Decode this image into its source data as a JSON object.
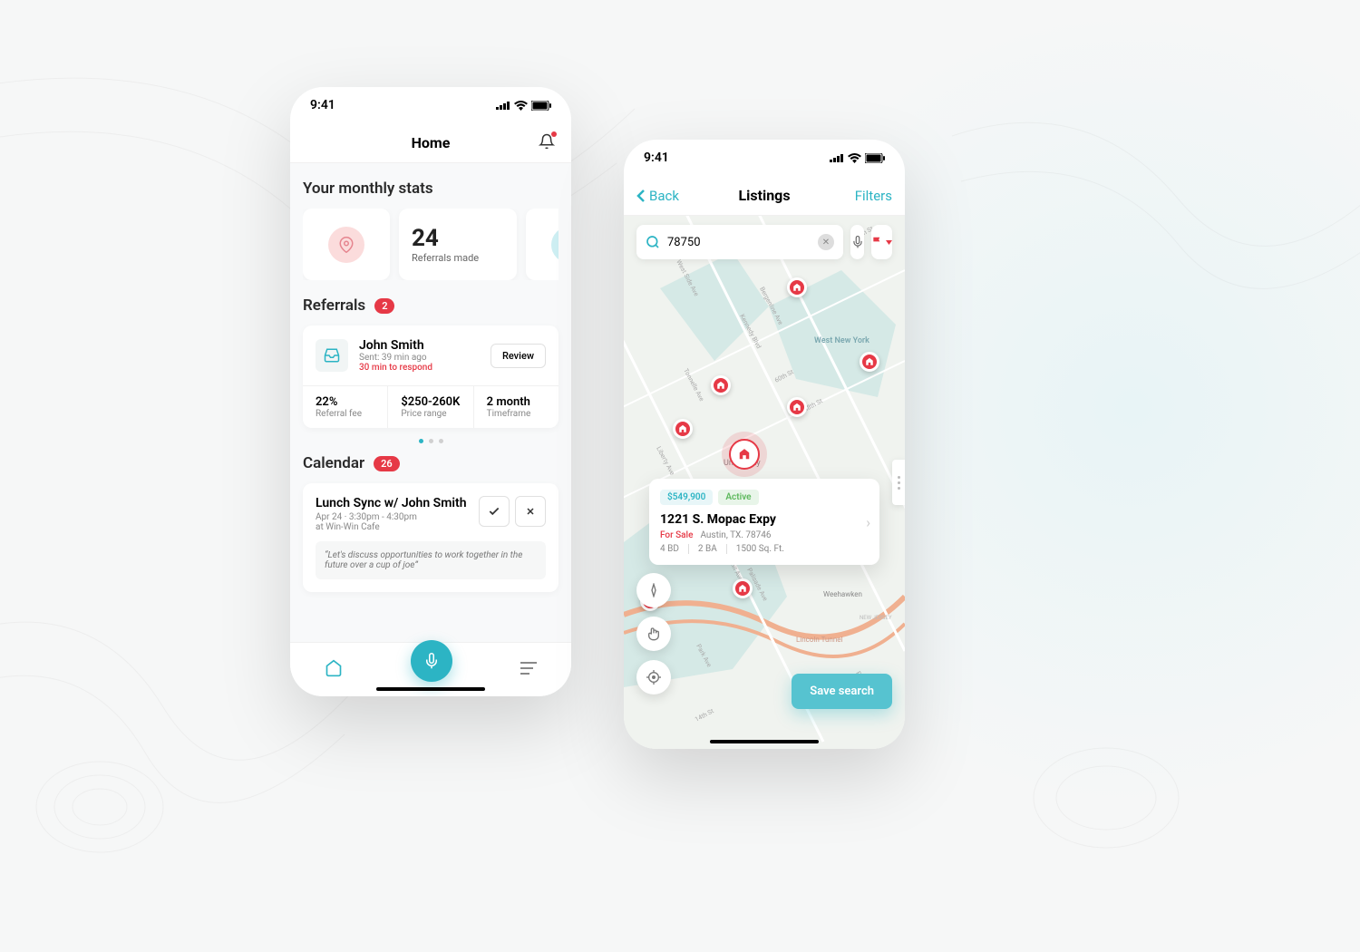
{
  "status_time": "9:41",
  "home": {
    "title": "Home",
    "stats_heading": "Your monthly stats",
    "stat_number": "24",
    "stat_label": "Referrals made",
    "referrals_heading": "Referrals",
    "referrals_badge": "2",
    "referral": {
      "name": "John Smith",
      "sent": "Sent: 39 min ago",
      "respond": "30 min to respond",
      "review": "Review",
      "fee_val": "22%",
      "fee_lbl": "Referral fee",
      "price_val": "$250-260K",
      "price_lbl": "Price range",
      "time_val": "2 month",
      "time_lbl": "Timeframe"
    },
    "calendar_heading": "Calendar",
    "calendar_badge": "26",
    "event": {
      "title": "Lunch Sync w/ John Smith",
      "time": "Apr 24 · 3:30pm - 4:30pm",
      "loc": "at Win-Win Cafe",
      "quote": "“Let's discuss opportunities to work together in the future over a cup of joe”"
    }
  },
  "listings": {
    "back": "Back",
    "title": "Listings",
    "filters": "Filters",
    "search_value": "78750",
    "card": {
      "price": "$549,900",
      "status": "Active",
      "address": "1221 S. Mopac Expy",
      "sale": "For Sale",
      "city": "Austin, TX. 78746",
      "bd": "4 BD",
      "ba": "2 BA",
      "sqft": "1500 Sq. Ft."
    },
    "save": "Save search",
    "map_labels": {
      "west_new_york": "West New York",
      "union_city": "Union City",
      "weehawken": "Weehawken",
      "lincoln": "Lincoln Tunnel",
      "nj": "NEW JERSEY"
    }
  }
}
